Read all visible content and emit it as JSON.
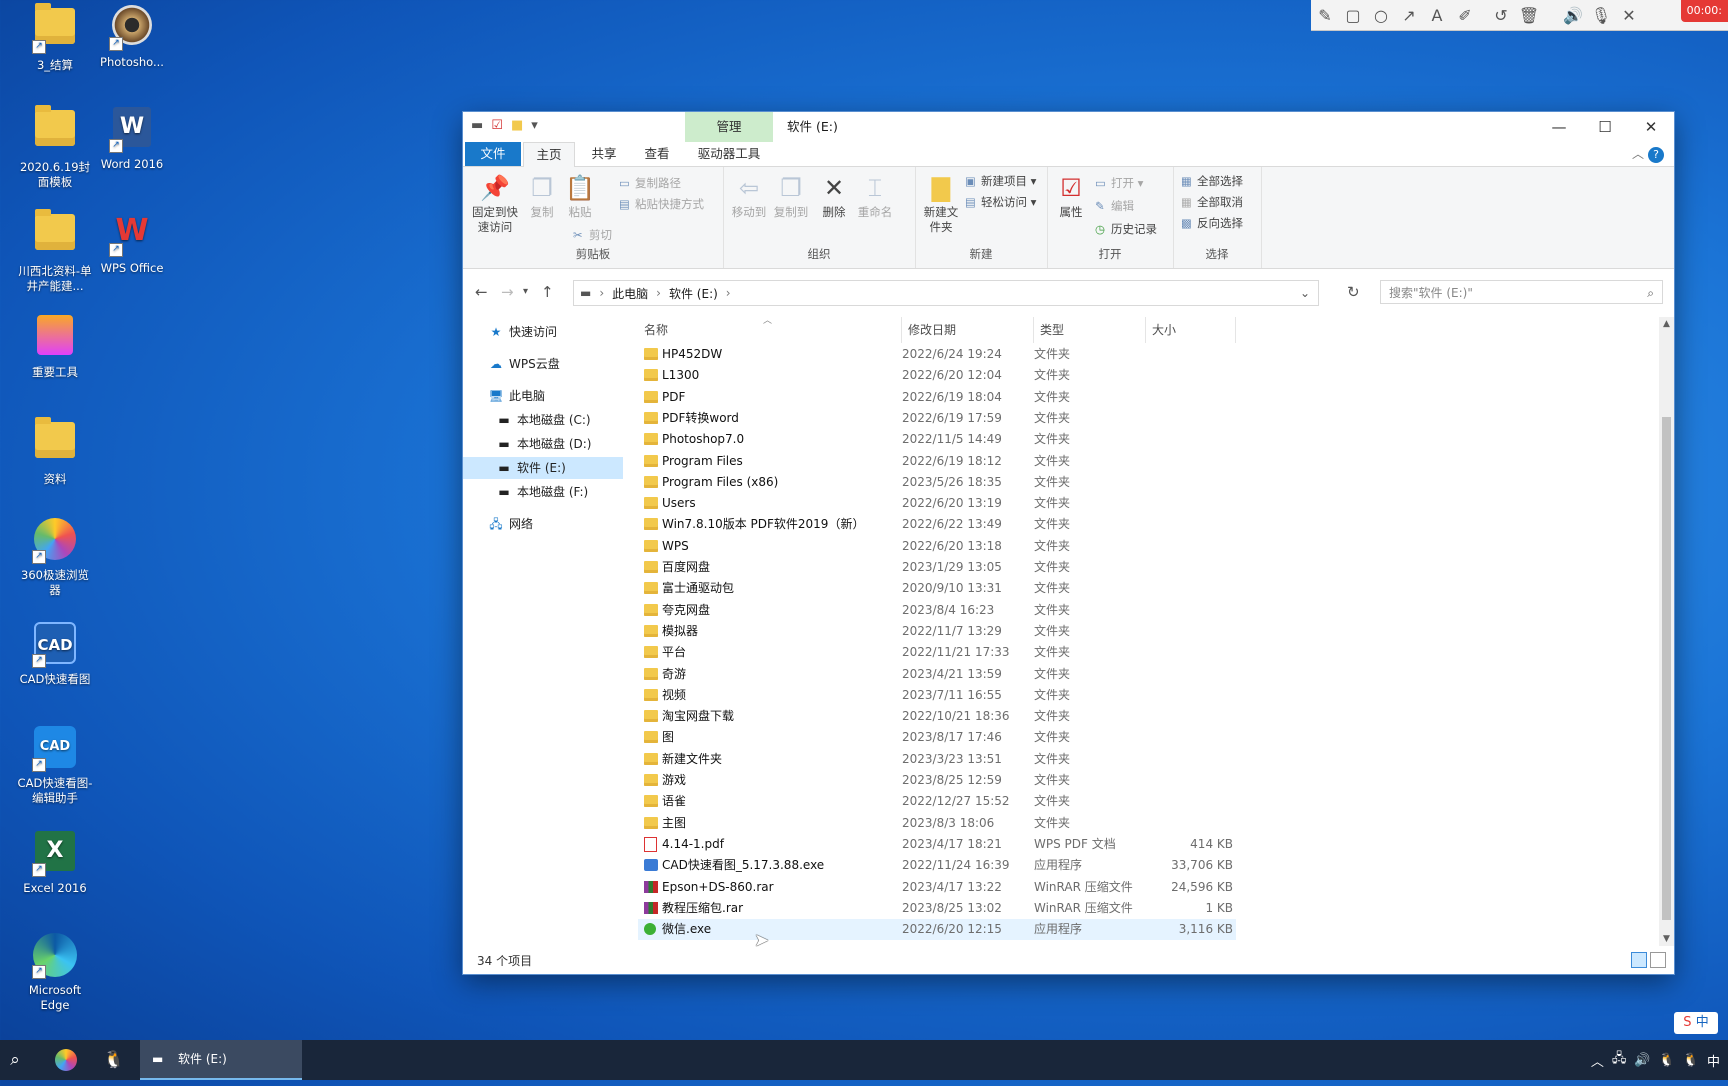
{
  "desktop": {
    "icons": [
      {
        "label": "3_结算",
        "type": "folder"
      },
      {
        "label": "Photosho...",
        "type": "app"
      },
      {
        "label": "2020.6.19封面模板",
        "type": "folder"
      },
      {
        "label": "Word 2016",
        "type": "word"
      },
      {
        "label": "川西北资料-单井产能建...",
        "type": "folder"
      },
      {
        "label": "WPS Office",
        "type": "wps"
      },
      {
        "label": "重要工具",
        "type": "app"
      },
      {
        "label": "资料",
        "type": "folder"
      },
      {
        "label": "360极速浏览器",
        "type": "browser"
      },
      {
        "label": "CAD快速看图",
        "type": "cad"
      },
      {
        "label": "CAD快速看图-编辑助手",
        "type": "cad"
      },
      {
        "label": "Excel 2016",
        "type": "excel"
      },
      {
        "label": "Microsoft Edge",
        "type": "edge"
      }
    ]
  },
  "recorder": {
    "time": "00:00:"
  },
  "window": {
    "context_tab": "管理",
    "title": "软件 (E:)",
    "tabs": {
      "file": "文件",
      "home": "主页",
      "share": "共享",
      "view": "查看",
      "drive_tools": "驱动器工具"
    },
    "help": "?",
    "ribbon": {
      "clipboard": {
        "label": "剪贴板",
        "pin": "固定到快速访问",
        "copy": "复制",
        "paste": "粘贴",
        "copy_path": "复制路径",
        "paste_shortcut": "粘贴快捷方式",
        "cut": "剪切"
      },
      "organize": {
        "label": "组织",
        "move_to": "移动到",
        "copy_to": "复制到",
        "delete": "删除",
        "rename": "重命名"
      },
      "new": {
        "label": "新建",
        "new_folder": "新建文件夹",
        "new_item": "新建项目",
        "easy_access": "轻松访问"
      },
      "open": {
        "label": "打开",
        "properties": "属性",
        "open": "打开",
        "edit": "编辑",
        "history": "历史记录"
      },
      "select": {
        "label": "选择",
        "select_all": "全部选择",
        "select_none": "全部取消",
        "invert": "反向选择"
      }
    },
    "address": {
      "crumb1": "此电脑",
      "crumb2": "软件 (E:)",
      "search_placeholder": "搜索\"软件 (E:)\""
    },
    "nav": [
      {
        "label": "快速访问",
        "icon": "star-icon"
      },
      {
        "label": "WPS云盘",
        "icon": "cloud-icon"
      },
      {
        "label": "此电脑",
        "icon": "pc-icon"
      },
      {
        "label": "本地磁盘 (C:)",
        "icon": "drive-icon"
      },
      {
        "label": "本地磁盘 (D:)",
        "icon": "drive-icon"
      },
      {
        "label": "软件 (E:)",
        "icon": "drive-icon"
      },
      {
        "label": "本地磁盘 (F:)",
        "icon": "drive-icon"
      },
      {
        "label": "网络",
        "icon": "network-icon"
      }
    ],
    "columns": {
      "name": "名称",
      "date": "修改日期",
      "type": "类型",
      "size": "大小"
    },
    "files": [
      {
        "name": "HP452DW",
        "date": "2022/6/24 19:24",
        "type": "文件夹",
        "size": "",
        "kind": "folder"
      },
      {
        "name": "L1300",
        "date": "2022/6/20 12:04",
        "type": "文件夹",
        "size": "",
        "kind": "folder"
      },
      {
        "name": "PDF",
        "date": "2022/6/19 18:04",
        "type": "文件夹",
        "size": "",
        "kind": "folder"
      },
      {
        "name": "PDF转换word",
        "date": "2022/6/19 17:59",
        "type": "文件夹",
        "size": "",
        "kind": "folder"
      },
      {
        "name": "Photoshop7.0",
        "date": "2022/11/5 14:49",
        "type": "文件夹",
        "size": "",
        "kind": "folder"
      },
      {
        "name": "Program Files",
        "date": "2022/6/19 18:12",
        "type": "文件夹",
        "size": "",
        "kind": "folder"
      },
      {
        "name": "Program Files (x86)",
        "date": "2023/5/26 18:35",
        "type": "文件夹",
        "size": "",
        "kind": "folder"
      },
      {
        "name": "Users",
        "date": "2022/6/20 13:19",
        "type": "文件夹",
        "size": "",
        "kind": "folder"
      },
      {
        "name": "Win7.8.10版本 PDF软件2019（新）",
        "date": "2022/6/22 13:49",
        "type": "文件夹",
        "size": "",
        "kind": "folder"
      },
      {
        "name": "WPS",
        "date": "2022/6/20 13:18",
        "type": "文件夹",
        "size": "",
        "kind": "folder"
      },
      {
        "name": "百度网盘",
        "date": "2023/1/29 13:05",
        "type": "文件夹",
        "size": "",
        "kind": "folder"
      },
      {
        "name": "富士通驱动包",
        "date": "2020/9/10 13:31",
        "type": "文件夹",
        "size": "",
        "kind": "folder"
      },
      {
        "name": "夸克网盘",
        "date": "2023/8/4 16:23",
        "type": "文件夹",
        "size": "",
        "kind": "folder"
      },
      {
        "name": "模拟器",
        "date": "2022/11/7 13:29",
        "type": "文件夹",
        "size": "",
        "kind": "folder"
      },
      {
        "name": "平台",
        "date": "2022/11/21 17:33",
        "type": "文件夹",
        "size": "",
        "kind": "folder"
      },
      {
        "name": "奇游",
        "date": "2023/4/21 13:59",
        "type": "文件夹",
        "size": "",
        "kind": "folder"
      },
      {
        "name": "视频",
        "date": "2023/7/11 16:55",
        "type": "文件夹",
        "size": "",
        "kind": "folder"
      },
      {
        "name": "淘宝网盘下载",
        "date": "2022/10/21 18:36",
        "type": "文件夹",
        "size": "",
        "kind": "folder"
      },
      {
        "name": "图",
        "date": "2023/8/17 17:46",
        "type": "文件夹",
        "size": "",
        "kind": "folder"
      },
      {
        "name": "新建文件夹",
        "date": "2023/3/23 13:51",
        "type": "文件夹",
        "size": "",
        "kind": "folder"
      },
      {
        "name": "游戏",
        "date": "2023/8/25 12:59",
        "type": "文件夹",
        "size": "",
        "kind": "folder"
      },
      {
        "name": "语雀",
        "date": "2022/12/27 15:52",
        "type": "文件夹",
        "size": "",
        "kind": "folder"
      },
      {
        "name": "主图",
        "date": "2023/8/3 18:06",
        "type": "文件夹",
        "size": "",
        "kind": "folder"
      },
      {
        "name": "4.14-1.pdf",
        "date": "2023/4/17 18:21",
        "type": "WPS PDF 文档",
        "size": "414 KB",
        "kind": "pdf"
      },
      {
        "name": "CAD快速看图_5.17.3.88.exe",
        "date": "2022/11/24 16:39",
        "type": "应用程序",
        "size": "33,706 KB",
        "kind": "exe"
      },
      {
        "name": "Epson+DS-860.rar",
        "date": "2023/4/17 13:22",
        "type": "WinRAR 压缩文件",
        "size": "24,596 KB",
        "kind": "rar"
      },
      {
        "name": "教程压缩包.rar",
        "date": "2023/8/25 13:02",
        "type": "WinRAR 压缩文件",
        "size": "1 KB",
        "kind": "rar"
      },
      {
        "name": "微信.exe",
        "date": "2022/6/20 12:15",
        "type": "应用程序",
        "size": "3,116 KB",
        "kind": "wx"
      }
    ],
    "status": "34 个项目"
  },
  "taskbar": {
    "app_label": "软件 (E:)",
    "ime": "中"
  },
  "colors": {
    "accent": "#1979ca",
    "selection": "#cce8ff",
    "folder": "#f2c94c",
    "taskbar": "#19263a"
  }
}
